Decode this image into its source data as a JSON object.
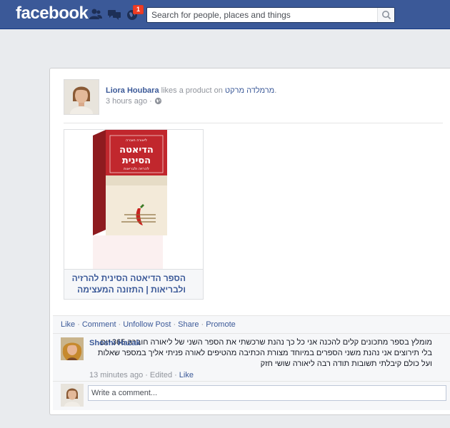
{
  "topbar": {
    "logo": "facebook",
    "notification_count": "1",
    "search_placeholder": "Search for people, places and things",
    "icons": [
      "friend-requests-icon",
      "messages-icon",
      "notifications-globe-icon",
      "search-icon"
    ]
  },
  "story": {
    "actor": "Liora Houbara",
    "verb": " likes a product on ",
    "page": "מרמלדה מרקט",
    "period": ".",
    "time": "3 hours ago",
    "middot": " · ",
    "privacy_icon": "globe-icon"
  },
  "product": {
    "title": "הספר הדיאטה הסינית להרזיה ולבריאות | התזונה המעצימה",
    "book_top": "ליאורה חוברה",
    "book_title_1": "הדיאטה",
    "book_title_2": "הסינית",
    "book_sub": "להרזיה ולבריאות"
  },
  "actions": [
    "Like",
    "Comment",
    "Unfollow Post",
    "Share",
    "Promote"
  ],
  "comment": {
    "author": "Shoshi Hazak",
    "text": "מומלץ בספר מתכונים קלים להכנה אני כל כך נהנת שרכשתי את הספר השני של ליאורה חוברה 365 יום בלי תירוצים אני נהנת משני הספרים במיוחד מצורת הכתיבה מהטיפים לאורה פניתי אליך במספר שאלות ועל כולם קיבלתי תשובות תודה רבה ליאורה שושי חזק",
    "time": "13 minutes ago",
    "edited": "Edited",
    "like": "Like"
  },
  "write": {
    "placeholder": "Write a comment..."
  },
  "colors": {
    "brand": "#3b5998",
    "badge": "#f03d25",
    "book_red": "#c1272d"
  }
}
